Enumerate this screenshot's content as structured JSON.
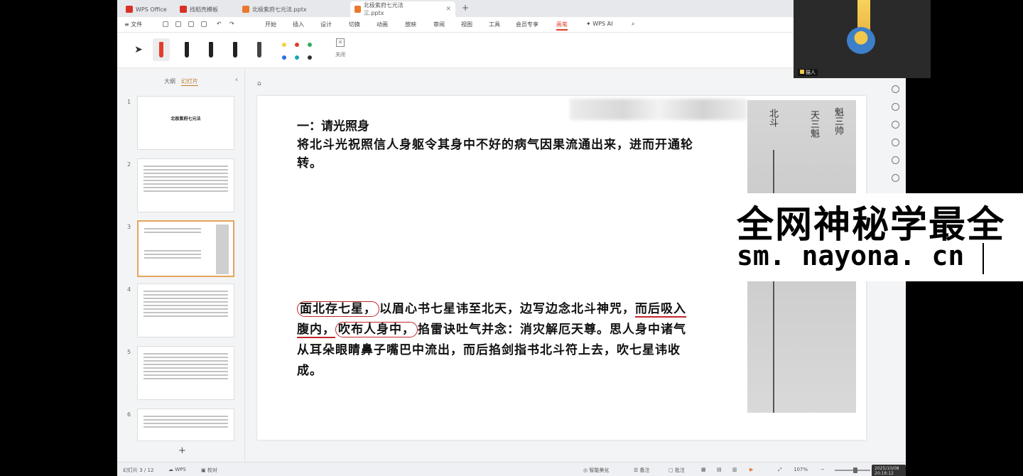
{
  "tabs": [
    {
      "label": "WPS Office",
      "color": "#d93025"
    },
    {
      "label": "找稻壳模板",
      "color": "#d93025"
    },
    {
      "label": "北极紫府七元法.pptx",
      "color": "#e8792e"
    },
    {
      "label": "北极紫府七元法三.pptx",
      "color": "#e8792e"
    }
  ],
  "menu": {
    "file": "文件",
    "items": [
      "开始",
      "插入",
      "设计",
      "切换",
      "动画",
      "放映",
      "审阅",
      "视图",
      "工具",
      "会员专享",
      "画笔"
    ],
    "wps_ai": "WPS AI"
  },
  "ribbon": {
    "close_label": "关闭",
    "swatches": [
      "#f2d33a",
      "#e03e2d",
      "#2fae5d",
      "#2f6fd6",
      "#19a5b5",
      "#333333"
    ]
  },
  "panel": {
    "outline_tab": "大纲",
    "slides_tab": "幻灯片",
    "slide1_title": "北极紫府七元法",
    "slide_numbers": [
      "1",
      "2",
      "3",
      "4",
      "5",
      "6"
    ],
    "add": "+"
  },
  "slide": {
    "heading": "一：请光照身",
    "para1": "将北斗光祝照信人身躯令其身中不好的病气因果流通出来，进而开通轮转。",
    "p2_circle1": "面北存七星，",
    "p2_t1": "以眉心书七星讳至北天，边写边念北斗神咒，",
    "p2_ul1": "而后吸入腹内，",
    "p2_circle2": "吹布人身中，",
    "p2_t2": "掐雷诀吐气并念：消灾解厄天尊。思人身中诸气从耳朵眼睛鼻子嘴巴中流出，而后掐剑指书北斗符上去，吹七星讳收成。",
    "scroll_chars": [
      "北斗",
      "天三魁",
      "魁三帅"
    ]
  },
  "status": {
    "slide_counter": "幻灯片 3 / 12",
    "wps": "WPS",
    "proofread": "校对",
    "beautify": "智能美化",
    "notes": "备注",
    "comment": "批注",
    "zoom": "107%",
    "datetime": "2025/10/08 20:16:12"
  },
  "webcam": {
    "name": "猫人"
  },
  "watermark": {
    "line1": "全网神秘学最全",
    "line2": "sm. nayona. cn"
  }
}
